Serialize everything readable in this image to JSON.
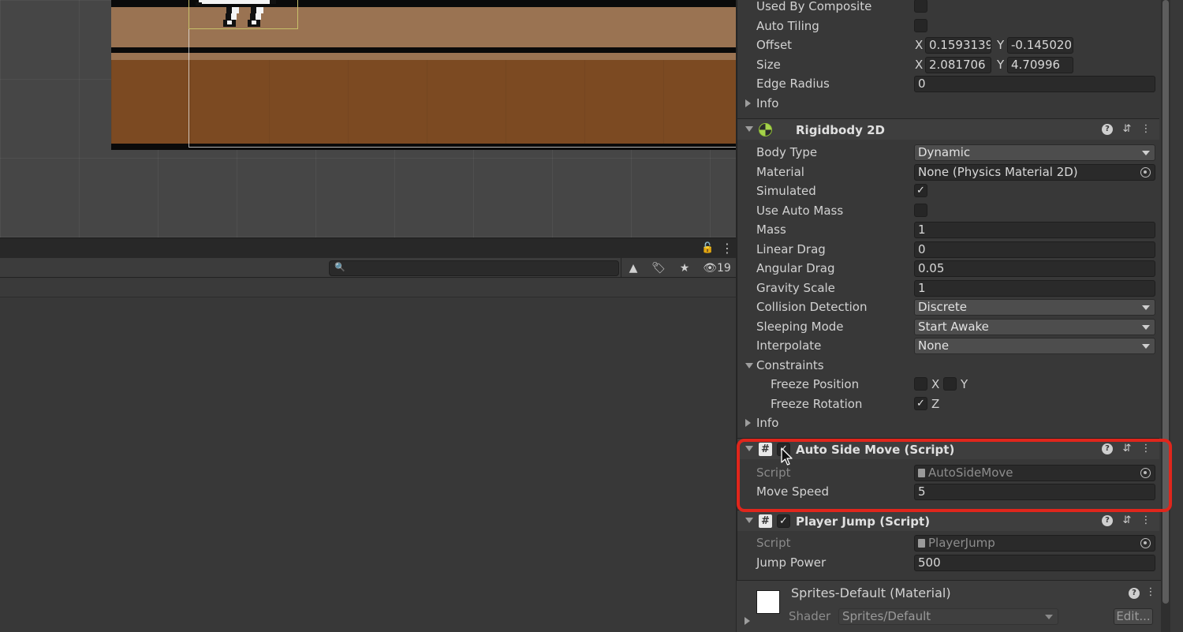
{
  "toolbar": {
    "visibility_count": "19",
    "search_placeholder": ""
  },
  "collider": {
    "used_by_composite_label": "Used By Composite",
    "auto_tiling_label": "Auto Tiling",
    "offset_label": "Offset",
    "offset_x_axis": "X",
    "offset_x": "0.1593139",
    "offset_y_axis": "Y",
    "offset_y": "-0.145020:",
    "size_label": "Size",
    "size_x_axis": "X",
    "size_x": "2.081706",
    "size_y_axis": "Y",
    "size_y": "4.70996",
    "edge_radius_label": "Edge Radius",
    "edge_radius": "0",
    "info_label": "Info"
  },
  "rigidbody": {
    "title": "Rigidbody 2D",
    "body_type_label": "Body Type",
    "body_type": "Dynamic",
    "material_label": "Material",
    "material": "None (Physics Material 2D)",
    "simulated_label": "Simulated",
    "simulated": true,
    "use_auto_mass_label": "Use Auto Mass",
    "use_auto_mass": false,
    "mass_label": "Mass",
    "mass": "1",
    "linear_drag_label": "Linear Drag",
    "linear_drag": "0",
    "angular_drag_label": "Angular Drag",
    "angular_drag": "0.05",
    "gravity_scale_label": "Gravity Scale",
    "gravity_scale": "1",
    "collision_detection_label": "Collision Detection",
    "collision_detection": "Discrete",
    "sleeping_mode_label": "Sleeping Mode",
    "sleeping_mode": "Start Awake",
    "interpolate_label": "Interpolate",
    "interpolate": "None",
    "constraints_label": "Constraints",
    "freeze_position_label": "Freeze Position",
    "freeze_position_x_label": "X",
    "freeze_position_y_label": "Y",
    "freeze_rotation_label": "Freeze Rotation",
    "freeze_rotation_z_label": "Z",
    "info_label": "Info"
  },
  "auto_side_move": {
    "title": "Auto Side Move (Script)",
    "enabled": true,
    "script_label": "Script",
    "script": "AutoSideMove",
    "move_speed_label": "Move Speed",
    "move_speed": "5"
  },
  "player_jump": {
    "title": "Player Jump (Script)",
    "enabled": true,
    "script_label": "Script",
    "script": "PlayerJump",
    "jump_power_label": "Jump Power",
    "jump_power": "500"
  },
  "material": {
    "name": "Sprites-Default (Material)",
    "shader_label": "Shader",
    "shader": "Sprites/Default",
    "edit_label": "Edit..."
  },
  "colors": {
    "highlight": "#e0261c",
    "ground_dark": "#7c4a22",
    "ground_light": "#9a7352",
    "inspector_bg": "#383838"
  }
}
